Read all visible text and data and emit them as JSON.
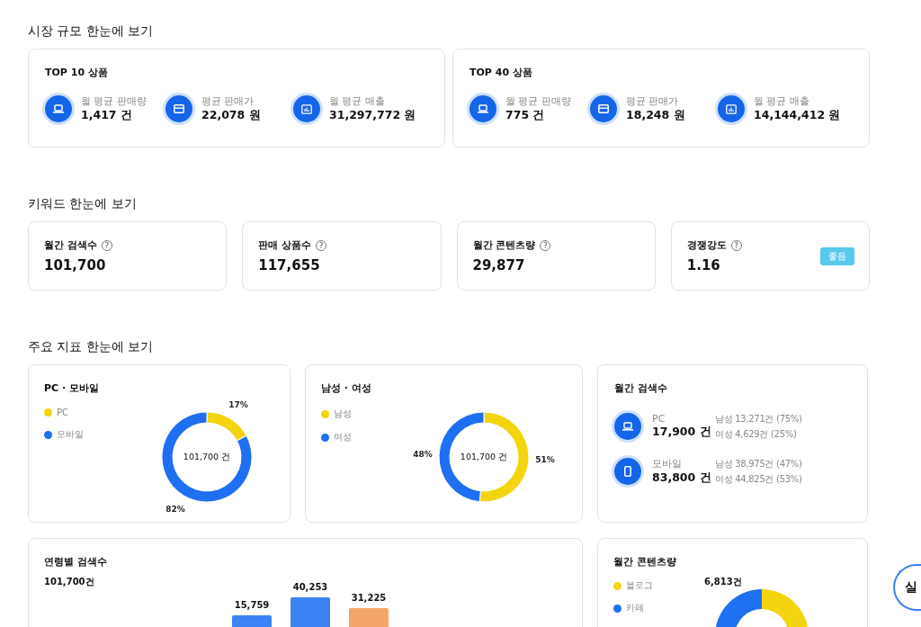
{
  "sections": [
    {
      "title": "시장 규모 한눈에 보기",
      "kind": "market",
      "cards": [
        {
          "title": "TOP 10 상품",
          "stats": [
            {
              "label": "월 평균 판매량",
              "value": "1,417 건"
            },
            {
              "label": "평균 판매가",
              "value": "22,078 원"
            },
            {
              "label": "월 평균 매출",
              "value": "31,297,772 원"
            }
          ]
        },
        {
          "title": "TOP 40 상품",
          "stats": [
            {
              "label": "월 평균 판매량",
              "value": "775 건"
            },
            {
              "label": "평균 판매가",
              "value": "18,248 원"
            },
            {
              "label": "월 평균 매출",
              "value": "14,144,412 원"
            }
          ]
        }
      ]
    },
    {
      "title": "키워드 한눈에 보기",
      "kind": "keyword",
      "cards": [
        {
          "label": "월간 검색수",
          "help": "?",
          "value": "101,700"
        },
        {
          "label": "판매 상품수",
          "help": "?",
          "value": "117,655"
        },
        {
          "label": "월간 콘텐츠량",
          "help": "?",
          "value": "29,877"
        },
        {
          "label": "경쟁강도",
          "help": "?",
          "value": "1.16",
          "badge": "좋음"
        }
      ]
    },
    {
      "title": "주요 지표 한눈에 보기",
      "kind": "indicators",
      "cards": [
        {
          "kind": "donut",
          "title": "PC · 모바일",
          "legend": [
            {
              "label": "PC",
              "color": "#f2d50f"
            },
            {
              "label": "모바일",
              "color": "#1e6ff1"
            }
          ],
          "center": "101,700 건",
          "chart_data": {
            "type": "donut",
            "values": [
              17,
              82
            ],
            "value_labels": [
              "17%",
              "82%"
            ]
          }
        },
        {
          "kind": "donut",
          "title": "남성 · 여성",
          "legend": [
            {
              "label": "남성",
              "color": "#f2d50f"
            },
            {
              "label": "여성",
              "color": "#1e6ff1"
            }
          ],
          "center": "101,700 건",
          "chart_data": {
            "type": "donut",
            "values": [
              51,
              48
            ],
            "value_labels": [
              "51%",
              "48%"
            ]
          }
        },
        {
          "kind": "search",
          "title": "월간 검색수",
          "rows": [
            {
              "label": "PC",
              "value": "17,900 건",
              "details": [
                "남성 13,271건 (75%)",
                "여성 4,629건 (25%)"
              ]
            },
            {
              "label": "모바일",
              "value": "83,800 건",
              "details": [
                "남성 38,975건 (47%)",
                "여성 44,825건 (53%)"
              ]
            }
          ]
        },
        {
          "kind": "bars",
          "title": "연령별 검색수",
          "subtitle": "101,700건",
          "bars": [
            {
              "label": "15,759",
              "color": "#3d82f5"
            },
            {
              "label": "40,253",
              "color": "#3d82f5"
            },
            {
              "label": "31,225",
              "color": "#f4a66a"
            }
          ]
        },
        {
          "kind": "content",
          "title": "월간 콘텐츠량",
          "legend": [
            {
              "label": "블로그",
              "color": "#f2d50f"
            },
            {
              "label": "카페",
              "color": "#1e6ff1"
            }
          ],
          "label": "6,813건"
        }
      ]
    }
  ],
  "floating_button": {
    "label": "실"
  }
}
